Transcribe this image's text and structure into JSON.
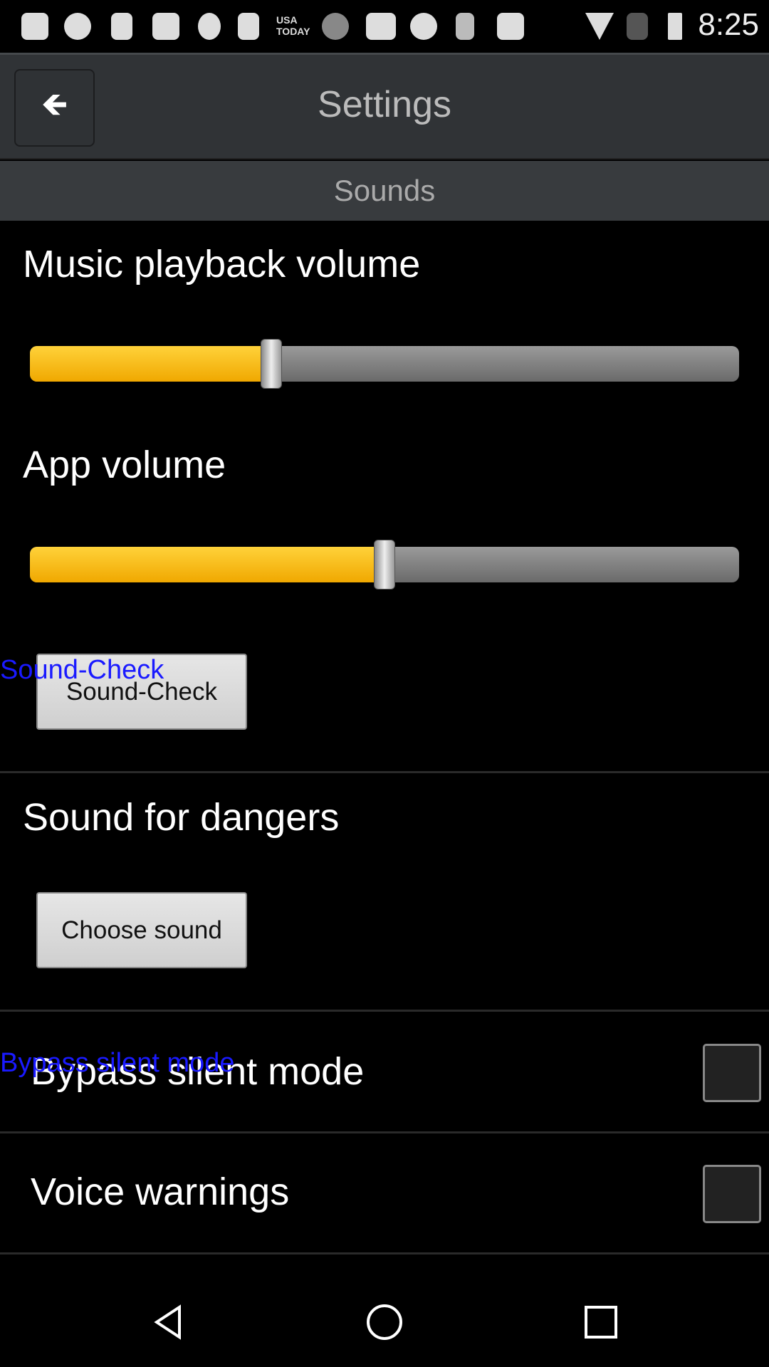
{
  "status_bar": {
    "time": "8:25",
    "icons": [
      "more-icon",
      "usb-icon",
      "facebook-icon",
      "telephone-icon",
      "moon-icon",
      "facebook-icon",
      "usa-today-icon",
      "link-icon",
      "cassette-icon",
      "soccer-icon",
      "violin-icon",
      "flipboard-icon",
      "wifi-icon",
      "no-sim-icon",
      "battery-charging-icon"
    ],
    "usa_today": "USA TODAY"
  },
  "header": {
    "title": "Settings",
    "back_icon": "arrow-left-icon"
  },
  "section": "Sounds",
  "music_volume": {
    "label": "Music playback volume",
    "value": 0.34
  },
  "app_volume": {
    "label": "App volume",
    "value": 0.5
  },
  "sound_check": {
    "button": "Sound-Check",
    "overlay": "Sound-Check"
  },
  "dangers": {
    "label": "Sound for dangers",
    "button": "Choose sound"
  },
  "bypass": {
    "label": "Bypass silent mode",
    "overlay": "Bypass silent mode",
    "checked": false
  },
  "voice": {
    "label": "Voice warnings",
    "checked": false
  },
  "nav": [
    "back-icon",
    "home-icon",
    "recents-icon"
  ]
}
